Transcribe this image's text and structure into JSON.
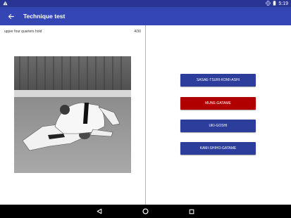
{
  "status_bar": {
    "time": "5:19",
    "icons": [
      "warning-icon",
      "vibrate-icon",
      "battery-icon"
    ]
  },
  "app_bar": {
    "title": "Technique test",
    "back_icon": "arrow-back-icon"
  },
  "question": {
    "text": "upper four quarters hold",
    "progress": "4/30"
  },
  "answers": [
    {
      "label": "SASAE-TSURI-KOMI-ASHI",
      "state": "default"
    },
    {
      "label": "MUNE-GATAME",
      "state": "wrong"
    },
    {
      "label": "UKI-GOSHI",
      "state": "default"
    },
    {
      "label": "KAMI-SHIHO-GATAME",
      "state": "default"
    }
  ],
  "colors": {
    "primary": "#3346b3",
    "status_bar": "#283593",
    "answer_default": "#2c3d9c",
    "answer_wrong": "#b00000"
  },
  "nav_bar": {
    "icons": [
      "back-triangle-icon",
      "home-circle-icon",
      "recents-square-icon"
    ]
  }
}
